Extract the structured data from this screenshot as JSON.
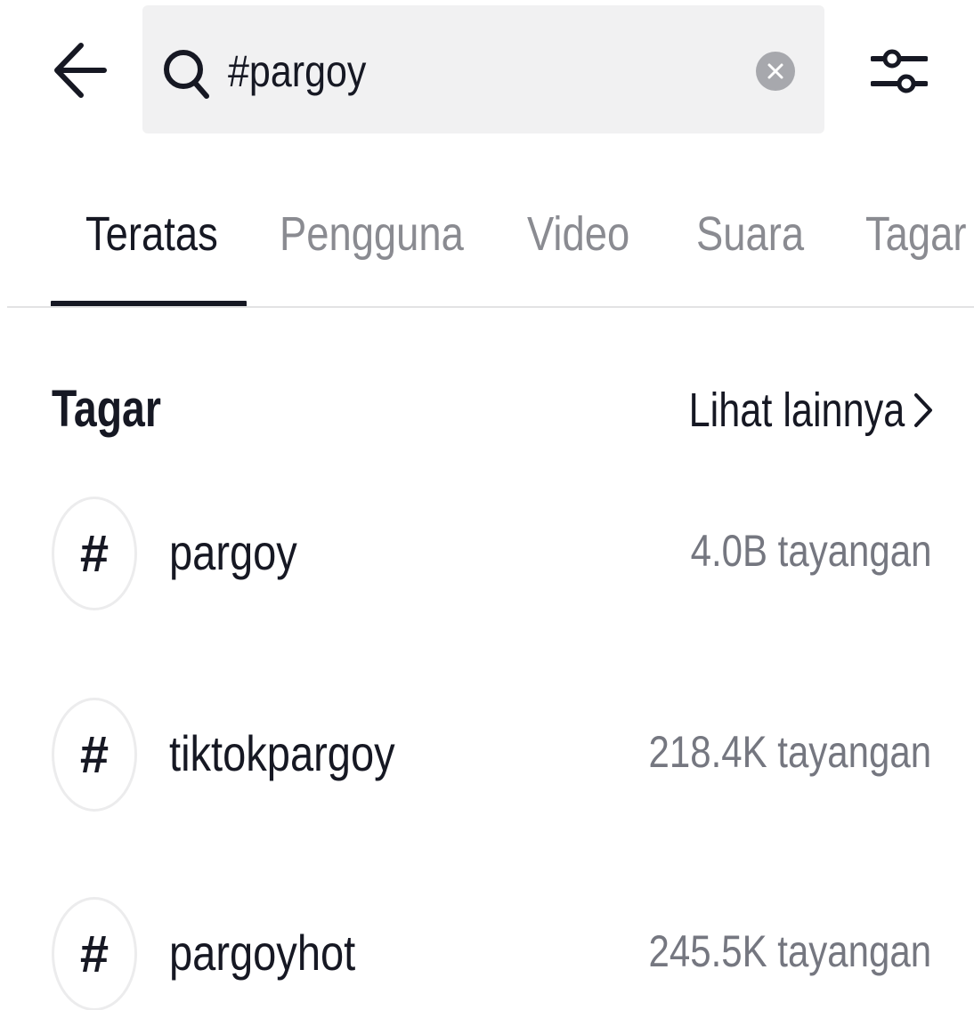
{
  "search": {
    "query": "#pargoy",
    "back_icon": "arrow-left-icon",
    "search_icon": "search-icon",
    "clear_icon": "clear-icon",
    "filter_icon": "filter-sliders-icon"
  },
  "tabs": [
    {
      "label": "Teratas",
      "active": true
    },
    {
      "label": "Pengguna",
      "active": false
    },
    {
      "label": "Video",
      "active": false
    },
    {
      "label": "Suara",
      "active": false
    },
    {
      "label": "Tagar",
      "active": false
    }
  ],
  "section": {
    "title": "Tagar",
    "see_more_label": "Lihat lainnya",
    "see_more_icon": "chevron-right-icon"
  },
  "hashtags": [
    {
      "symbol": "#",
      "name": "pargoy",
      "views": "4.0B tayangan"
    },
    {
      "symbol": "#",
      "name": "tiktokpargoy",
      "views": "218.4K tayangan"
    },
    {
      "symbol": "#",
      "name": "pargoyhot",
      "views": "245.5K tayangan"
    }
  ],
  "colors": {
    "text_primary": "#161823",
    "text_secondary": "#757780",
    "tab_inactive": "#8a8b91",
    "search_bg": "#f1f1f2"
  }
}
